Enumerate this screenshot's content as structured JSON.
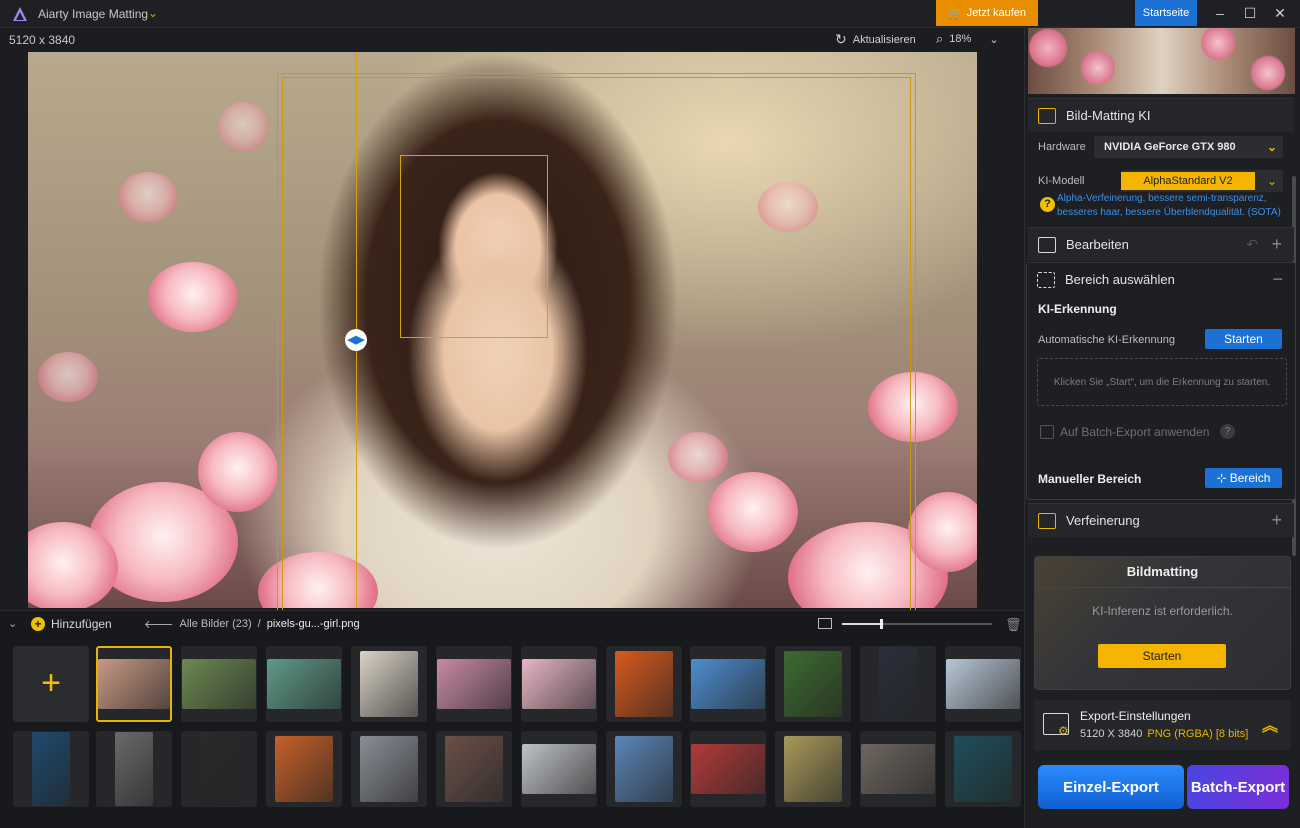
{
  "app": {
    "title": "Aiarty Image Matting",
    "buy_label": "Jetzt kaufen",
    "home_label": "Startseite"
  },
  "toolbar": {
    "image_size": "5120 x 3840",
    "refresh_label": "Aktualisieren",
    "zoom": "18%"
  },
  "thumbbar": {
    "add_label": "Hinzufügen",
    "all_images": "Alle Bilder (23)",
    "separator": "/",
    "current_file": "pixels-gu...-girl.png",
    "thumbs": [
      {
        "color": "#c99a84"
      },
      {
        "color": "#6c8a52"
      },
      {
        "color": "#5f9a88"
      },
      {
        "color": "#d9d2c6"
      },
      {
        "color": "#c98aa6"
      },
      {
        "color": "#e6b6c4"
      },
      {
        "color": "#d95a1e"
      },
      {
        "color": "#4d8ed0"
      },
      {
        "color": "#3d6b2f"
      },
      {
        "color": "#2a2f3a"
      },
      {
        "color": "#b9c7d6"
      },
      {
        "color": "#1f4a6e"
      },
      {
        "color": "#6a6a6a"
      },
      {
        "color": "#2a2a2a"
      },
      {
        "color": "#c7602a"
      },
      {
        "color": "#8a8e96"
      },
      {
        "color": "#6a5048"
      },
      {
        "color": "#bfc2c6"
      },
      {
        "color": "#5a86b8"
      },
      {
        "color": "#b23a3a"
      },
      {
        "color": "#a89a5a"
      },
      {
        "color": "#6e6660"
      },
      {
        "color": "#1f4e5a"
      }
    ]
  },
  "panel": {
    "section_matting": "Bild-Matting KI",
    "hardware_label": "Hardware",
    "hardware_value": "NVIDIA GeForce GTX 980",
    "model_label": "KI-Modell",
    "model_value": "AlphaStandard  V2",
    "model_desc": "Alpha-Verfeinerung, bessere semi-transparenz, besseres haar, bessere Überblendqualität. (SOTA)",
    "section_edit": "Bearbeiten",
    "section_area": "Bereich auswählen",
    "ki_detection_title": "KI-Erkennung",
    "auto_detection_label": "Automatische KI-Erkennung",
    "start_label": "Starten",
    "drop_hint": "Klicken Sie „Start“, um die Erkennung zu starten.",
    "batch_apply_label": "Auf Batch-Export anwenden",
    "manual_area_title": "Manueller Bereich",
    "area_button": "Bereich",
    "section_refine": "Verfeinerung",
    "matting_title": "Bildmatting",
    "matting_hint": "KI-Inferenz ist erforderlich.",
    "matting_start": "Starten",
    "export_title": "Export-Einstellungen",
    "export_size": "5120 X 3840",
    "export_format": "PNG (RGBA) [8 bits]",
    "single_export": "Einzel-Export",
    "batch_export": "Batch-Export"
  }
}
